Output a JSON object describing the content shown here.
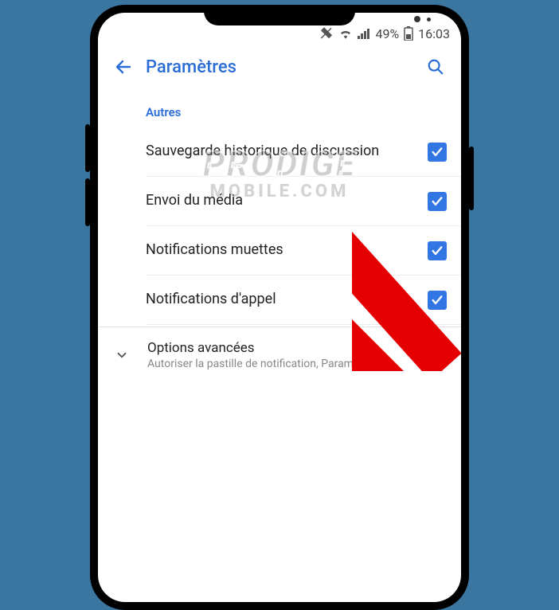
{
  "status": {
    "battery_pct": "49%",
    "time": "16:03"
  },
  "appbar": {
    "title": "Paramètres"
  },
  "section": {
    "label": "Autres"
  },
  "rows": [
    {
      "label": "Sauvegarde historique de discussion",
      "checked": true
    },
    {
      "label": "Envoi du média",
      "checked": true
    },
    {
      "label": "Notifications muettes",
      "checked": true
    },
    {
      "label": "Notifications d'appel",
      "checked": true
    }
  ],
  "advanced": {
    "title": "Options avancées",
    "subtitle": "Autoriser la pastille de notification, Paramètr.."
  },
  "watermark": {
    "line1": "PRODIGE",
    "line2": "MOBILE.COM"
  }
}
